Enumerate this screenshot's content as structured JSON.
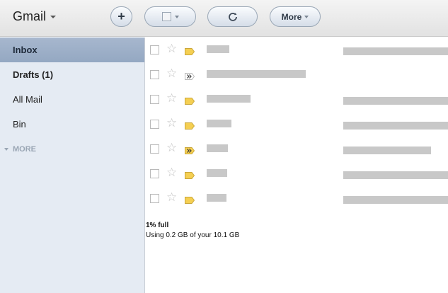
{
  "app": {
    "title": "Gmail"
  },
  "toolbar": {
    "compose_icon": "plus-icon",
    "select_icon": "checkbox-icon",
    "refresh_icon": "refresh-icon",
    "more_label": "More"
  },
  "sidebar": {
    "items": [
      {
        "label": "Inbox"
      },
      {
        "label": "Drafts (1)"
      },
      {
        "label": "All Mail"
      },
      {
        "label": "Bin"
      }
    ],
    "more_label": "MORE"
  },
  "messages": {
    "rows": [
      {
        "tag": "label-icon",
        "important": false
      },
      {
        "tag": "forward-icon",
        "important": false
      },
      {
        "tag": "label-icon",
        "important": false
      },
      {
        "tag": "label-icon",
        "important": false
      },
      {
        "tag": "forward-icon",
        "important": true
      },
      {
        "tag": "label-icon",
        "important": false
      },
      {
        "tag": "label-icon",
        "important": false
      }
    ]
  },
  "storage": {
    "percent_full": "1% full",
    "usage": "Using 0.2 GB of your 10.1 GB"
  },
  "colors": {
    "toolbar_bg": "#e8e8e8",
    "sidebar_bg": "#e5ebf3",
    "active_item_bg": "#9fb0c8",
    "label_tag": "#f5cf52",
    "redacted_text": "#c8c8c8"
  }
}
